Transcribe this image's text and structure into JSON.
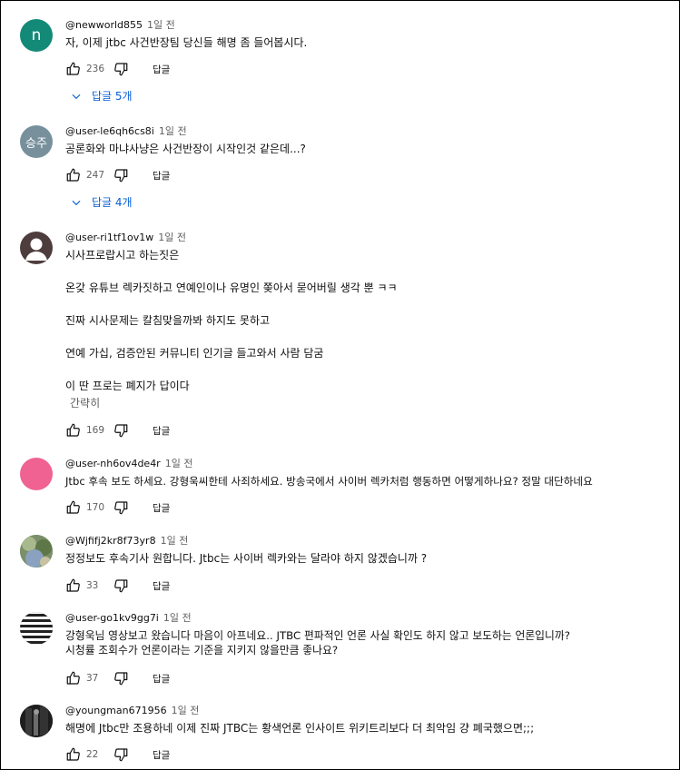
{
  "comments": [
    {
      "author": "@newworld855",
      "time": "1일 전",
      "avatar_text": "n",
      "avatar_color": "#138a78",
      "lines": [
        "자, 이제 jtbc 사건반장팀 당신들 해명 좀 들어봅시다."
      ],
      "likes": "236",
      "reply_label": "답글",
      "replies_label": "답글 5개"
    },
    {
      "author": "@user-le6qh6cs8i",
      "time": "1일 전",
      "avatar_text": "승주",
      "avatar_color": "#78909c",
      "lines": [
        "공론화와 마냐사냥은 사건반장이 시작인것 같은데...?"
      ],
      "likes": "247",
      "reply_label": "답글",
      "replies_label": "답글 4개"
    },
    {
      "author": "@user-ri1tf1ov1w",
      "time": "1일 전",
      "avatar_icon": "default-person-icon",
      "avatar_color": "#4e3d3d",
      "paragraphs": [
        "시사프로랍시고 하는짓은",
        "온갖 유튜브 렉카짓하고 연예인이나 유명인 쫒아서 묻어버릴 생각 뿐 ㅋㅋ",
        "진짜 시사문제는 칼침맞을까봐 하지도 못하고",
        "연예 가십, 검증안된 커뮤니티 인기글 들고와서 사람 담굼",
        "이 딴 프로는 폐지가 답이다"
      ],
      "read_more": "간략히",
      "likes": "169",
      "reply_label": "답글"
    },
    {
      "author": "@user-nh6ov4de4r",
      "time": "1일 전",
      "avatar_color": "#f06292",
      "lines": [
        "Jtbc 후속 보도 하세요. 강형욱씨한테 사죄하세요. 방송국에서 사이버 렉카처럼 행동하면 어떻게하나요? 정말 대단하네요"
      ],
      "likes": "170",
      "reply_label": "답글"
    },
    {
      "author": "@Wjfifj2kr8f73yr8",
      "time": "1일 전",
      "avatar_icon": "photo-avatar-icon",
      "avatar_color": "#6d8a5a",
      "lines": [
        "정정보도 후속기사 원합니다. Jtbc는 사이버 렉카와는 달라야 하지 않겠습니까 ?"
      ],
      "likes": "33",
      "reply_label": "답글"
    },
    {
      "author": "@user-go1kv9gg7i",
      "time": "1일 전",
      "avatar_icon": "striped-avatar-icon",
      "avatar_color": "#222222",
      "lines": [
        "강형욱님 영상보고 왔습니다 마음이 아프네요.. JTBC 편파적인 언론 사실 확인도 하지 않고 보도하는 언론입니까?",
        "시청률 조회수가 언론이라는 기준을 지키지 않을만큼 좋나요?"
      ],
      "likes": "37",
      "reply_label": "답글"
    },
    {
      "author": "@youngman671956",
      "time": "1일 전",
      "avatar_icon": "photo-avatar-icon",
      "avatar_color": "#2b2b2b",
      "lines": [
        "해명에 Jtbc만 조용하네 이제 진짜 JTBC는 황색언론 인사이트 위키트리보다 더 최악임 걍 폐국했으면;;;"
      ],
      "likes": "22",
      "reply_label": "답글"
    }
  ]
}
